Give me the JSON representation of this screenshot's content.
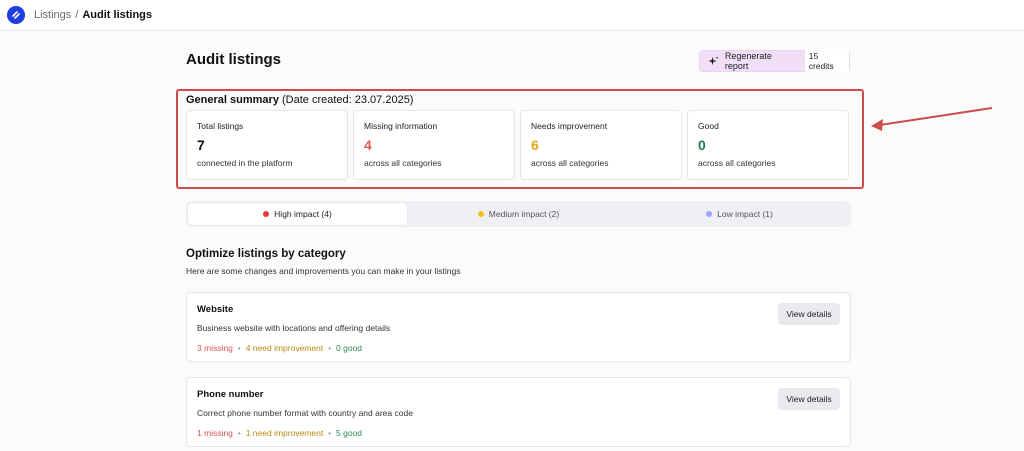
{
  "breadcrumb": {
    "parent": "Listings",
    "separator": "/",
    "current": "Audit listings"
  },
  "page": {
    "title": "Audit listings"
  },
  "regenerate": {
    "label": "Regenerate report",
    "credits": "15 credits"
  },
  "summary": {
    "title": "General summary",
    "date_note": "(Date created: 23.07.2025)",
    "cards": [
      {
        "label": "Total listings",
        "value": "7",
        "sub": "connected in the platform",
        "color": "#111111"
      },
      {
        "label": "Missing information",
        "value": "4",
        "sub": "across all categories",
        "color": "#e05a5a"
      },
      {
        "label": "Needs improvement",
        "value": "6",
        "sub": "across all categories",
        "color": "#e0a81c"
      },
      {
        "label": "Good",
        "value": "0",
        "sub": "across all categories",
        "color": "#1f7a4d"
      }
    ]
  },
  "tabs": [
    {
      "label": "High impact (4)",
      "dot": "#e03b3b",
      "active": true
    },
    {
      "label": "Medium impact (2)",
      "dot": "#f2c01e",
      "active": false
    },
    {
      "label": "Low impact (1)",
      "dot": "#9aa6ff",
      "active": false
    }
  ],
  "optimize": {
    "title": "Optimize listings by category",
    "subtitle": "Here are some changes and improvements you can make in your listings"
  },
  "categories": [
    {
      "name": "Website",
      "description": "Business website with locations and offering details",
      "missing": "3 missing",
      "improve": "4 need improvement",
      "good": "0 good",
      "button": "View details"
    },
    {
      "name": "Phone number",
      "description": "Correct phone number format with country and area code",
      "missing": "1 missing",
      "improve": "1 need improvement",
      "good": "5 good",
      "button": "View details"
    }
  ],
  "colors": {
    "accent": "#1f3fe0",
    "highlight": "#cf4b4b",
    "regen_bg": "#f1dff7"
  },
  "icons": {
    "logo": "swap-icon",
    "regenerate": "sparkle-icon"
  }
}
